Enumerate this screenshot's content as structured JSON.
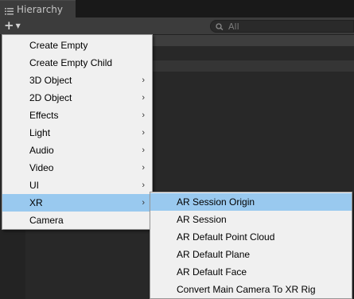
{
  "window": {
    "tab_title": "Hierarchy",
    "tab_icon": "list-icon",
    "add_icon": "plus-icon",
    "search_icon": "search-icon",
    "search_placeholder": "All"
  },
  "create_menu": {
    "items": [
      {
        "label": "Create Empty",
        "submenu": false
      },
      {
        "label": "Create Empty Child",
        "submenu": false
      },
      {
        "label": "3D Object",
        "submenu": true
      },
      {
        "label": "2D Object",
        "submenu": true
      },
      {
        "label": "Effects",
        "submenu": true
      },
      {
        "label": "Light",
        "submenu": true
      },
      {
        "label": "Audio",
        "submenu": true
      },
      {
        "label": "Video",
        "submenu": true
      },
      {
        "label": "UI",
        "submenu": true
      },
      {
        "label": "XR",
        "submenu": true,
        "highlighted": true
      },
      {
        "label": "Camera",
        "submenu": false
      }
    ],
    "chevron_icon": "chevron-right-icon"
  },
  "xr_submenu": {
    "items": [
      {
        "label": "AR Session Origin",
        "highlighted": true
      },
      {
        "label": "AR Session"
      },
      {
        "label": "AR Default Point Cloud"
      },
      {
        "label": "AR Default Plane"
      },
      {
        "label": "AR Default Face"
      },
      {
        "label": "Convert Main Camera To XR Rig"
      }
    ]
  },
  "colors": {
    "menu_background": "#f0f0f0",
    "menu_highlight": "#99c9ef",
    "window_background": "#282828",
    "toolbar": "#3c3c3c"
  }
}
